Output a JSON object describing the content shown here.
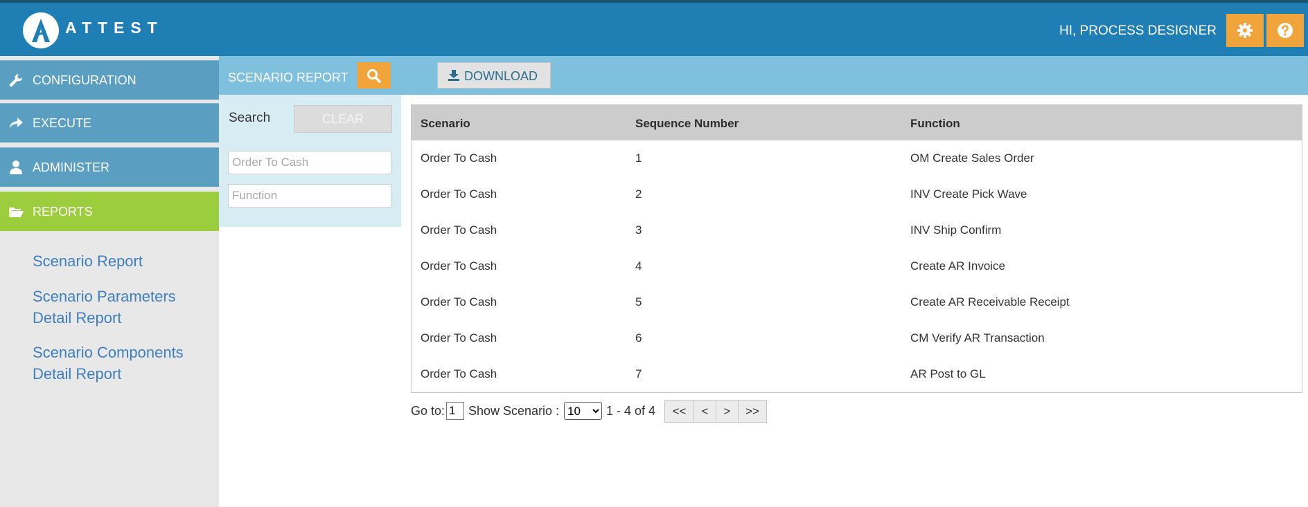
{
  "app": {
    "brand": "ATTEST",
    "greeting": "HI, PROCESS DESIGNER"
  },
  "colors": {
    "header": "#1f7fb4",
    "nav": "#5a9fc2",
    "nav_active": "#9ccd3c",
    "accent": "#f0a43a",
    "toolbar": "#7fc0de"
  },
  "header_icons": [
    "gear-icon",
    "help-icon"
  ],
  "sidebar": {
    "nav": [
      {
        "label": "CONFIGURATION",
        "icon": "wrench-icon"
      },
      {
        "label": "EXECUTE",
        "icon": "share-arrow-icon"
      },
      {
        "label": "ADMINISTER",
        "icon": "user-icon"
      },
      {
        "label": "REPORTS",
        "icon": "folder-open-icon",
        "active": true
      }
    ],
    "links": [
      {
        "label": "Scenario Report"
      },
      {
        "label": "Scenario Parameters Detail Report"
      },
      {
        "label": "Scenario Components Detail Report"
      }
    ]
  },
  "toolbar": {
    "title": "SCENARIO REPORT",
    "download_label": "DOWNLOAD"
  },
  "filters": {
    "search_label": "Search",
    "clear_label": "CLEAR",
    "scenario_placeholder": "Order To Cash",
    "scenario_value": "",
    "function_placeholder": "Function",
    "function_value": ""
  },
  "table": {
    "columns": [
      "Scenario",
      "Sequence Number",
      "Function"
    ],
    "rows": [
      {
        "scenario": "Order To Cash",
        "seq": "1",
        "function": "OM Create Sales Order"
      },
      {
        "scenario": "Order To Cash",
        "seq": "2",
        "function": "INV Create Pick Wave"
      },
      {
        "scenario": "Order To Cash",
        "seq": "3",
        "function": "INV Ship Confirm"
      },
      {
        "scenario": "Order To Cash",
        "seq": "4",
        "function": "Create AR Invoice"
      },
      {
        "scenario": "Order To Cash",
        "seq": "5",
        "function": "Create AR Receivable Receipt"
      },
      {
        "scenario": "Order To Cash",
        "seq": "6",
        "function": "CM Verify AR Transaction"
      },
      {
        "scenario": "Order To Cash",
        "seq": "7",
        "function": "AR Post to GL"
      }
    ]
  },
  "pager": {
    "goto_label": "Go to:",
    "goto_value": "1",
    "show_label": "Show Scenario :",
    "page_size": "10",
    "range": "1 - 4 of 4",
    "first": "<<",
    "prev": "<",
    "next": ">",
    "last": ">>"
  }
}
